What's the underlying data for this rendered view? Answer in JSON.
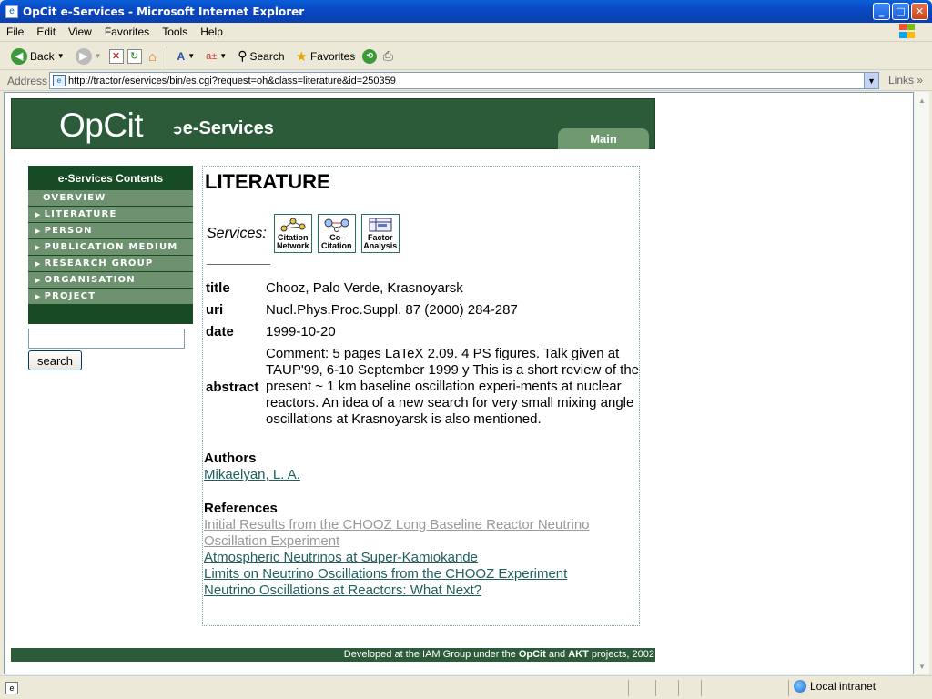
{
  "window": {
    "title": "OpCit e-Services - Microsoft Internet Explorer"
  },
  "menu": [
    "File",
    "Edit",
    "View",
    "Favorites",
    "Tools",
    "Help"
  ],
  "toolbar": {
    "back": "Back",
    "search": "Search",
    "favorites": "Favorites"
  },
  "address": {
    "label": "Address",
    "url": "http://tractor/eservices/bin/es.cgi?request=oh&class=literature&id=250359",
    "links": "Links"
  },
  "site": {
    "logo": "OpCit",
    "subtitle": "e-Services",
    "main_tab": "Main",
    "sidebar": {
      "heading": "e-Services Contents",
      "items": [
        "OVERVIEW",
        "LITERATURE",
        "PERSON",
        "PUBLICATION MEDIUM",
        "RESEARCH GROUP",
        "ORGANISATION",
        "PROJECT"
      ]
    },
    "search_button": "search"
  },
  "record": {
    "heading": "LITERATURE",
    "services_label": "Services:",
    "services": [
      {
        "line1": "Citation",
        "line2": "Network"
      },
      {
        "line1": "Co-",
        "line2": "Citation"
      },
      {
        "line1": "Factor",
        "line2": "Analysis"
      }
    ],
    "fields": {
      "title_key": "title",
      "title": "Chooz, Palo Verde, Krasnoyarsk",
      "uri_key": "uri",
      "uri": "Nucl.Phys.Proc.Suppl. 87 (2000) 284-287",
      "date_key": "date",
      "date": "1999-10-20",
      "abstract_key": "abstract",
      "abstract": "Comment: 5 pages LaTeX 2.09. 4 PS figures. Talk given at TAUP'99, 6-10 September 1999 y This is a short review of the present ~ 1 km baseline oscillation experi-ments at nuclear reactors. An idea of a new search for very small mixing angle oscillations at Krasnoyarsk is also mentioned."
    },
    "authors_heading": "Authors",
    "authors": [
      "Mikaelyan, L. A."
    ],
    "references_heading": "References",
    "references": [
      "Initial Results from the CHOOZ Long Baseline Reactor Neutrino Oscillation Experiment",
      "Atmospheric Neutrinos at Super-Kamiokande",
      "Limits on Neutrino Oscillations from the CHOOZ Experiment",
      "Neutrino Oscillations at Reactors: What Next?"
    ]
  },
  "footer": {
    "pre": "Developed at the IAM Group under the ",
    "b1": "OpCit",
    "mid": " and ",
    "b2": "AKT",
    "post": " projects, 2002"
  },
  "status": {
    "zone": "Local intranet"
  }
}
